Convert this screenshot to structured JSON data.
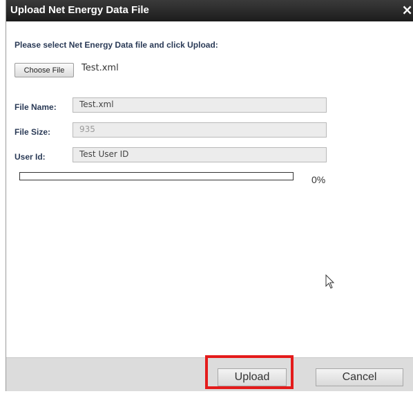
{
  "dialog": {
    "title": "Upload Net Energy Data File",
    "close_glyph": "×"
  },
  "prompt": "Please select Net Energy Data file and click Upload:",
  "file_picker": {
    "button_label": "Choose File",
    "chosen_file": "Test.xml"
  },
  "fields": {
    "file_name": {
      "label": "File Name:",
      "value": "Test.xml"
    },
    "file_size": {
      "label": "File Size:",
      "value": "935"
    },
    "user_id": {
      "label": "User Id:",
      "value": "Test User ID"
    }
  },
  "progress": {
    "value": 0,
    "label": "0%",
    "fill_color": "#4a7bc8"
  },
  "footer": {
    "upload_label": "Upload",
    "cancel_label": "Cancel"
  },
  "colors": {
    "titlebar": "#1c1c1c",
    "label_text": "#2a3a56",
    "highlight": "#e41b1b"
  },
  "icons": {
    "close": "close-icon",
    "cursor": "mouse-pointer-icon"
  }
}
